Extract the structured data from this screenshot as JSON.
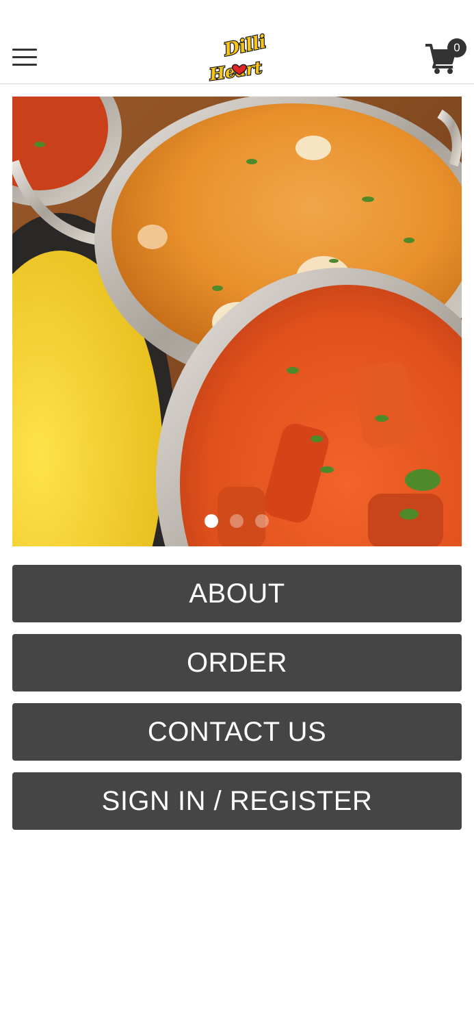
{
  "header": {
    "logo_text_top": "Dilli",
    "logo_text_bottom": "Heart",
    "cart_count": "0"
  },
  "hero": {
    "slide_count": 3,
    "active_slide": 1
  },
  "buttons": {
    "about": "ABOUT",
    "order": "ORDER",
    "contact": "CONTACT US",
    "signin": "SIGN IN / REGISTER"
  },
  "colors": {
    "button_bg": "#454545",
    "button_text": "#ffffff",
    "header_icons": "#333333",
    "logo_yellow": "#f5c518",
    "logo_red": "#e02424"
  },
  "icons": {
    "menu": "hamburger-menu-icon",
    "cart": "shopping-cart-icon"
  }
}
